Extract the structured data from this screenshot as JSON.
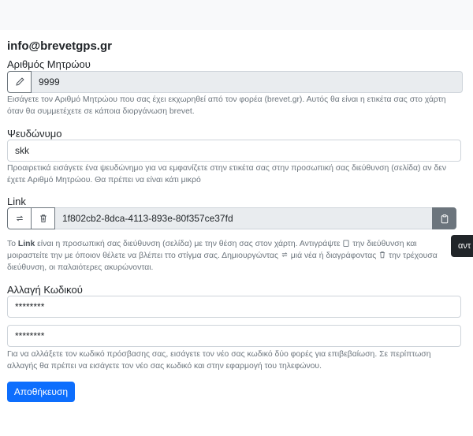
{
  "header": {
    "email": "info@brevetgps.gr"
  },
  "registration": {
    "label": "Αριθμός Μητρώου",
    "value": "9999",
    "help": "Εισάγετε τον Αριθμό Μητρώου που σας έχει εκχωρηθεί από τον φορέα (brevet.gr). Αυτός θα είναι η ετικέτα σας στο χάρτη όταν θα συμμετέχετε σε κάποια διοργάνωση brevet."
  },
  "nickname": {
    "label": "Ψευδώνυμο",
    "value": "skk",
    "help": "Προαιρετικά εισάγετε ένα ψευδώνημο για να εμφανίζετε στην ετικέτα σας στην προσωπική σας διεύθυνση (σελίδα) αν δεν έχετε Αριθμό Μητρώου. Θα πρέπει να είναι κάτι μικρό"
  },
  "link": {
    "label": "Link",
    "value": "1f802cb2-8dca-4113-893e-80f357ce37fd",
    "help_pre": "Το ",
    "help_bold": "Link",
    "help_1": " είναι η προσωπική σας διεύθυνση (σελίδα) με την θέση σας στον χάρτη. Αντιγράψτε ",
    "help_2": " την διεύθυνση και μοιραστείτε την με όποιον θέλετε να βλέπει ττο στίγμα σας. Δημιουργώντας ",
    "help_3": " μιά νέα ή διαγράφοντας ",
    "help_4": " την τρέχουσα διεύθυνση, οι παλαιότερες ακυρώνονται."
  },
  "tooltip": {
    "text": "αντ"
  },
  "password": {
    "label": "Αλλαγή Κωδικού",
    "value1": "********",
    "value2": "********",
    "help": "Για να αλλάξετε τον κωδικό πρόσβασης σας, εισάγετε τον νέο σας κωδικό δύο φορές για επιβεβαίωση. Σε περίπτωση αλλαγής θα πρέπει να εισάγετε τον νέο σας κωδικό και στην εφαρμογή του τηλεφώνου."
  },
  "actions": {
    "save_label": "Αποθήκευση"
  },
  "icons": {
    "registration_addon": "pencil-icon",
    "link_refresh": "refresh-icon",
    "link_delete": "trash-icon",
    "link_copy": "clipboard-icon"
  },
  "colors": {
    "primary": "#0d6efd",
    "secondary": "#6c757d",
    "readonly_bg": "#e9ecef",
    "help_text": "#6c757d"
  }
}
